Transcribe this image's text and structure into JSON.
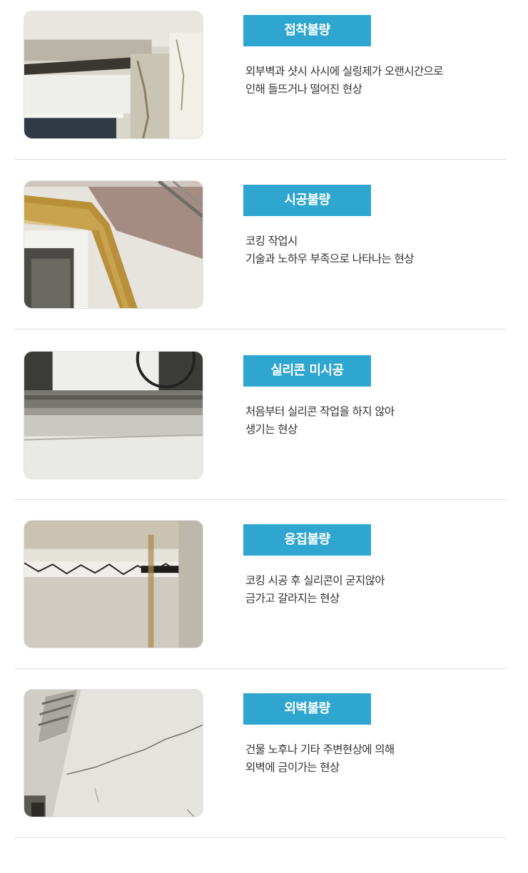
{
  "items": [
    {
      "title": "접착불량",
      "desc": [
        "외부벽과 샷시 사시에 실링제가 오랜시간으로",
        "인해 들뜨거나 떨어진 현상"
      ],
      "photo_icon": "peeling-sealant-photo"
    },
    {
      "title": "시공불량",
      "desc": [
        "코킹 작업시",
        "기술과 노하우 부족으로 나타나는 현상"
      ],
      "photo_icon": "stained-window-frame-photo"
    },
    {
      "title": "실리콘 미시공",
      "desc": [
        "처음부터 실리콘 작업을 하지 않아",
        "생기는 현상"
      ],
      "photo_icon": "missing-silicone-photo"
    },
    {
      "title": "응집불량",
      "desc": [
        "코킹 시공 후 실리콘이 굳지않아",
        "금가고 갈라지는 현상"
      ],
      "photo_icon": "cracked-caulking-photo"
    },
    {
      "title": "외벽불량",
      "desc": [
        "건물 노후나 기타 주변현상에 의해",
        "외벽에 금이가는 현상"
      ],
      "photo_icon": "cracked-wall-photo"
    }
  ],
  "colors": {
    "badge": "#2ea6d0",
    "text": "#333333",
    "divider": "#e0e0e0"
  }
}
